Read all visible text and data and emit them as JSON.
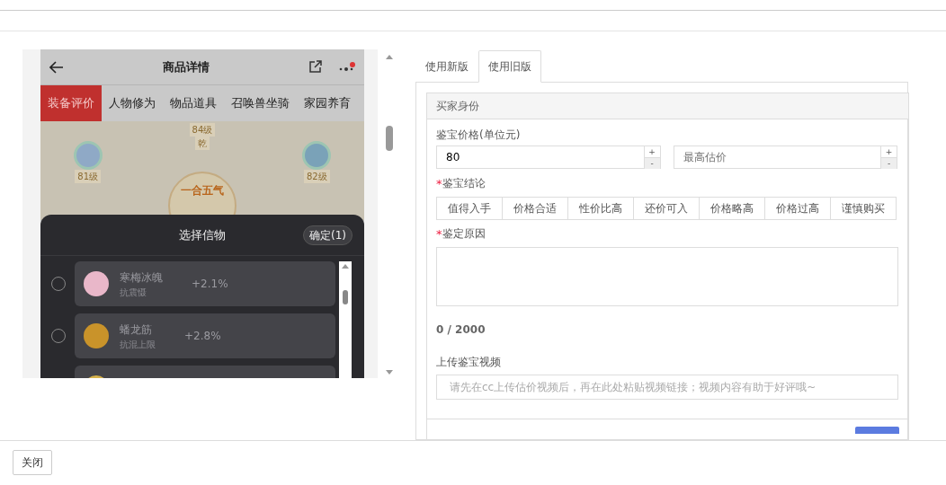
{
  "phone": {
    "title": "商品详情",
    "tabs": [
      {
        "label": "装备评价",
        "selected": true
      },
      {
        "label": "人物修为",
        "selected": false
      },
      {
        "label": "物品道具",
        "selected": false
      },
      {
        "label": "召唤兽坐骑",
        "selected": false
      },
      {
        "label": "家园养育",
        "selected": false
      }
    ],
    "art": {
      "levels": [
        "84级",
        "81级",
        "82级"
      ],
      "trigram": "乾",
      "center_title": "一合五气"
    },
    "sheet": {
      "title": "选择信物",
      "confirm": "确定(1)",
      "items": [
        {
          "name": "寒梅冰魄",
          "attribute": "抗震慑",
          "bonus": "+2.1%",
          "selected": false
        },
        {
          "name": "蟠龙筋",
          "attribute": "抗混上限",
          "bonus": "+2.8%",
          "selected": false
        }
      ]
    }
  },
  "tabs": [
    {
      "label": "使用新版",
      "selected": false
    },
    {
      "label": "使用旧版",
      "selected": true
    }
  ],
  "form": {
    "section": "买家身份",
    "price_label": "鉴宝价格(单位元)",
    "price_value": "80",
    "max_placeholder": "最高估价",
    "spin_up": "+",
    "spin_down": "-",
    "conclusion_mark": "*",
    "conclusion_label": "鉴宝结论",
    "options": [
      {
        "label": "值得入手",
        "selected": false
      },
      {
        "label": "价格合适",
        "selected": false
      },
      {
        "label": "性价比高",
        "selected": false
      },
      {
        "label": "还价可入",
        "selected": false
      },
      {
        "label": "价格略高",
        "selected": false
      },
      {
        "label": "价格过高",
        "selected": false
      },
      {
        "label": "谨慎购买",
        "selected": false
      }
    ],
    "reason_mark": "*",
    "reason_label": "鉴定原因",
    "counter": "0 / 2000",
    "video_label": "上传鉴宝视频",
    "video_placeholder": "请先在cc上传估价视频后，再在此处粘贴视频链接；视频内容有助于好评哦~"
  },
  "footer": {
    "close": "关闭"
  }
}
